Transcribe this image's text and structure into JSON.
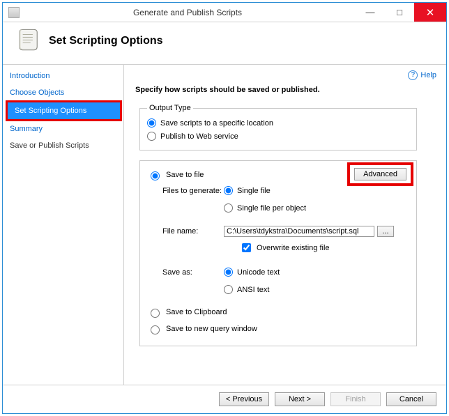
{
  "window": {
    "title": "Generate and Publish Scripts"
  },
  "header": {
    "subtitle": "Set Scripting Options"
  },
  "help": {
    "label": "Help"
  },
  "sidebar": {
    "items": [
      {
        "label": "Introduction"
      },
      {
        "label": "Choose Objects"
      },
      {
        "label": "Set Scripting Options"
      },
      {
        "label": "Summary"
      },
      {
        "label": "Save or Publish Scripts"
      }
    ]
  },
  "content": {
    "instruction": "Specify how scripts should be saved or published.",
    "output_type": {
      "legend": "Output Type",
      "opt_save": "Save scripts to a specific location",
      "opt_publish": "Publish to Web service"
    },
    "advanced_label": "Advanced",
    "save_to_file": "Save to file",
    "files_to_generate_label": "Files to generate:",
    "single_file": "Single file",
    "single_per_object": "Single file per object",
    "file_name_label": "File name:",
    "file_name_value": "C:\\Users\\tdykstra\\Documents\\script.sql",
    "browse_label": "...",
    "overwrite": "Overwrite existing file",
    "save_as_label": "Save as:",
    "unicode": "Unicode text",
    "ansi": "ANSI text",
    "save_clipboard": "Save to Clipboard",
    "save_new_query": "Save to new query window"
  },
  "footer": {
    "previous": "< Previous",
    "next": "Next >",
    "finish": "Finish",
    "cancel": "Cancel"
  }
}
